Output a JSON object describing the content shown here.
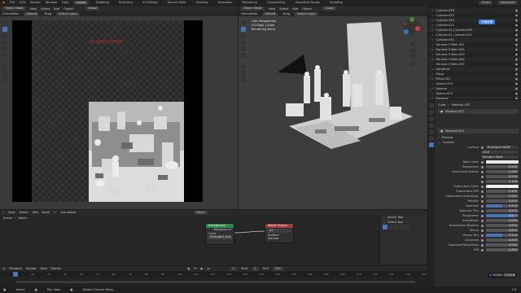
{
  "topbar": {
    "menus": [
      "File",
      "Edit",
      "Render",
      "Window",
      "Help"
    ],
    "workspaces": [
      "Layout",
      "Modeling",
      "Sculpting",
      "UV Editing",
      "Texture Paint",
      "Shading",
      "Animation",
      "Rendering",
      "Compositing",
      "Geometry Nodes",
      "Scripting"
    ],
    "active_workspace": "Layout",
    "scene": "Scene",
    "view_layer": "ViewLayer"
  },
  "left_viewport": {
    "mode": "Object Mode",
    "menus": [
      "View",
      "Select",
      "Add",
      "Object"
    ],
    "orientation": "Global",
    "header2": [
      "Orientation",
      "Default",
      "Drag",
      "Select Lasso"
    ],
    "watermark": "30 6080238986"
  },
  "right_viewport": {
    "mode": "Object Mode",
    "menus": [
      "View",
      "Select",
      "Add",
      "Object"
    ],
    "orientation": "Global",
    "header2": [
      "Orientation",
      "Default",
      "Drag",
      "Select Lasso"
    ],
    "overlay_lines": [
      "User Perspective",
      "(0) Body | Cube",
      "Rendering Done"
    ]
  },
  "outliner": {
    "items": [
      "Cylinder.036",
      "Cylinder.035",
      "Cylinder.049",
      "Cylinder.032",
      "Cylinder.02_Cylinder.005",
      "Cylinder.02_Cylinder.001",
      "Cylinder.031",
      "Genesis 3 Male.001",
      "Genesis 3 Male.002",
      "Genesis 3 Male.003",
      "Genesis 3 Male.004",
      "Genesis 3 Male.005",
      "Armature",
      "Plane",
      "Plane.001",
      "Sphere.002",
      "Spherei",
      "Sphere.003",
      "Suzanne"
    ],
    "badge": "切换视图"
  },
  "properties": {
    "object": "Cube",
    "material_tab": "Material.003",
    "slot": "Material.003",
    "material_name": "Material.003",
    "section_preview": "Preview",
    "section_surface": "Surface",
    "surface_label": "Surface",
    "surface_value": "Principled BSDF",
    "distribution": "GGX",
    "subsurface_method": "Random Walk",
    "rows": [
      {
        "label": "Base Color",
        "value": "",
        "fill": 0
      },
      {
        "label": "Subsurface",
        "value": "0.000",
        "fill": 0
      },
      {
        "label": "Subsurface Radius",
        "value": "1.000",
        "fill": 0
      },
      {
        "label": "",
        "value": "0.200",
        "fill": 0
      },
      {
        "label": "",
        "value": "0.100",
        "fill": 0
      },
      {
        "label": "Subsurface Color",
        "value": "",
        "fill": 0
      },
      {
        "label": "Subsurface IOR",
        "value": "1.400",
        "fill": 0
      },
      {
        "label": "Subsurface Anisotropy",
        "value": "0.000",
        "fill": 0
      },
      {
        "label": "Metallic",
        "value": "0.000",
        "fill": 0
      },
      {
        "label": "Specular",
        "value": "0.500",
        "fill": 0.5
      },
      {
        "label": "Specular Tint",
        "value": "0.000",
        "fill": 0
      },
      {
        "label": "Roughness",
        "value": "0.873",
        "fill": 0.873
      },
      {
        "label": "Anisotropic",
        "value": "0.000",
        "fill": 0
      },
      {
        "label": "Anisotropic Rotation",
        "value": "0.000",
        "fill": 0
      },
      {
        "label": "Sheen",
        "value": "0.000",
        "fill": 0
      },
      {
        "label": "Sheen Tint",
        "value": "0.500",
        "fill": 0.5
      },
      {
        "label": "Clearcoat",
        "value": "0.000",
        "fill": 0
      },
      {
        "label": "Clearcoat Roughness",
        "value": "0.030",
        "fill": 0.03
      },
      {
        "label": "IOR",
        "value": "1.450",
        "fill": 0
      }
    ],
    "corner_badge": "NVIDIA 控制面板"
  },
  "node_editor": {
    "menus": [
      "View",
      "Select",
      "Add",
      "Node"
    ],
    "use_nodes": "Use Nodes",
    "slot_label": "World",
    "header_left": [
      "Scene",
      "World"
    ],
    "bg_node": {
      "title": "Background",
      "out": "Background",
      "color": "Color",
      "strength_label": "Strength",
      "strength": "1.000"
    },
    "out_node": {
      "title": "World Output",
      "target": "All",
      "surface": "Surface",
      "volume": "Volume"
    },
    "active_tool": {
      "title": "Active Tool",
      "name": "Select Box"
    }
  },
  "timeline": {
    "menus": [
      "Playback",
      "Keying",
      "View",
      "Marker"
    ],
    "frames": [
      "0",
      "10",
      "20",
      "30",
      "40",
      "50",
      "60",
      "70",
      "80",
      "90",
      "100",
      "110",
      "120",
      "130",
      "140",
      "150",
      "160",
      "170",
      "180",
      "190",
      "200",
      "210",
      "220",
      "230",
      "240",
      "250"
    ],
    "current": "1",
    "start_label": "Start",
    "start": "1",
    "end_label": "End",
    "end": "250"
  },
  "statusbar": {
    "select": "Select",
    "pan": "Pan View",
    "context": "Object Context Menu",
    "version": "3.6"
  },
  "colors": {
    "accent": "#4772b3",
    "bg_node": "#2f8a4a",
    "out_node": "#a63b3b",
    "badge": "#3d7be0"
  }
}
